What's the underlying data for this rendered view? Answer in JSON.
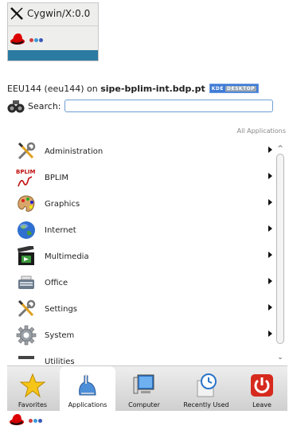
{
  "mini_panel": {
    "title": "Cygwin/X:0.0",
    "dot_colors": [
      "#d04040",
      "#3a9ad9",
      "#3a58b8"
    ]
  },
  "header": {
    "user": "EEU144 (eeu144)",
    "on_word": "on",
    "host": "sipe-bplim-int.bdp.pt",
    "badge_left": "KDE",
    "badge_right": "DESKTOP"
  },
  "search": {
    "label": "Search:",
    "value": "",
    "placeholder": ""
  },
  "list_header": "All Applications",
  "apps": [
    {
      "label": "Administration",
      "icon": "tools-icon"
    },
    {
      "label": "BPLIM",
      "icon": "bplim-logo-icon",
      "logo_text": "BPLIM"
    },
    {
      "label": "Graphics",
      "icon": "palette-icon"
    },
    {
      "label": "Internet",
      "icon": "globe-icon"
    },
    {
      "label": "Multimedia",
      "icon": "film-icon"
    },
    {
      "label": "Office",
      "icon": "typewriter-icon"
    },
    {
      "label": "Settings",
      "icon": "tools-icon"
    },
    {
      "label": "System",
      "icon": "gear-icon"
    },
    {
      "label": "Utilities",
      "icon": "utilities-icon"
    }
  ],
  "tabs": [
    {
      "label": "Favorites",
      "icon": "star-icon",
      "active": false
    },
    {
      "label": "Applications",
      "icon": "applications-icon",
      "active": true
    },
    {
      "label": "Computer",
      "icon": "computer-icon",
      "active": false
    },
    {
      "label": "Recently Used",
      "icon": "clock-icon",
      "active": false
    },
    {
      "label": "Leave",
      "icon": "power-icon",
      "active": false
    }
  ],
  "colors": {
    "accent_blue": "#2b7aa1",
    "leave_red": "#d62a1e",
    "star_yellow": "#f5c518"
  }
}
